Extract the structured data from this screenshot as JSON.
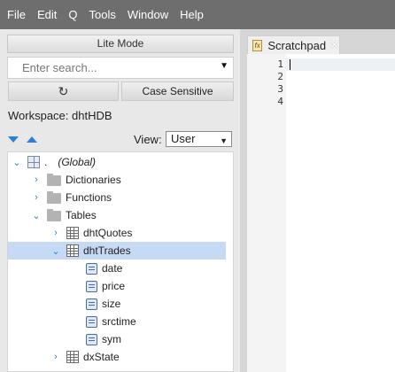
{
  "menu": [
    "File",
    "Edit",
    "Q",
    "Tools",
    "Window",
    "Help"
  ],
  "left": {
    "lite_mode": "Lite Mode",
    "search_placeholder": "Enter search...",
    "refresh_glyph": "↻",
    "case_sensitive": "Case Sensitive",
    "workspace": "Workspace: dhtHDB",
    "view_label": "View:",
    "view_value": "User"
  },
  "tree": [
    {
      "twisty": "⌄",
      "icon": "global",
      "label": "(Global)",
      "prefix": ".",
      "level": 0,
      "italic": true
    },
    {
      "twisty": "›",
      "icon": "folder",
      "label": "Dictionaries",
      "level": 1
    },
    {
      "twisty": "›",
      "icon": "folder",
      "label": "Functions",
      "level": 1
    },
    {
      "twisty": "⌄",
      "icon": "folder",
      "label": "Tables",
      "level": 1
    },
    {
      "twisty": "›",
      "icon": "table",
      "label": "dhtQuotes",
      "level": 2
    },
    {
      "twisty": "⌄",
      "icon": "table",
      "label": "dhtTrades",
      "level": 2,
      "selected": true
    },
    {
      "twisty": "",
      "icon": "column",
      "label": "date",
      "level": 3
    },
    {
      "twisty": "",
      "icon": "column",
      "label": "price",
      "level": 3
    },
    {
      "twisty": "",
      "icon": "column",
      "label": "size",
      "level": 3
    },
    {
      "twisty": "",
      "icon": "column",
      "label": "srctime",
      "level": 3
    },
    {
      "twisty": "",
      "icon": "column",
      "label": "sym",
      "level": 3
    },
    {
      "twisty": "›",
      "icon": "table",
      "label": "dxState",
      "level": 2
    }
  ],
  "editor": {
    "tab_label": "Scratchpad",
    "tab_icon": "fx",
    "close_glyph": "✕",
    "line_numbers": [
      "1",
      "2",
      "3",
      "4"
    ]
  }
}
